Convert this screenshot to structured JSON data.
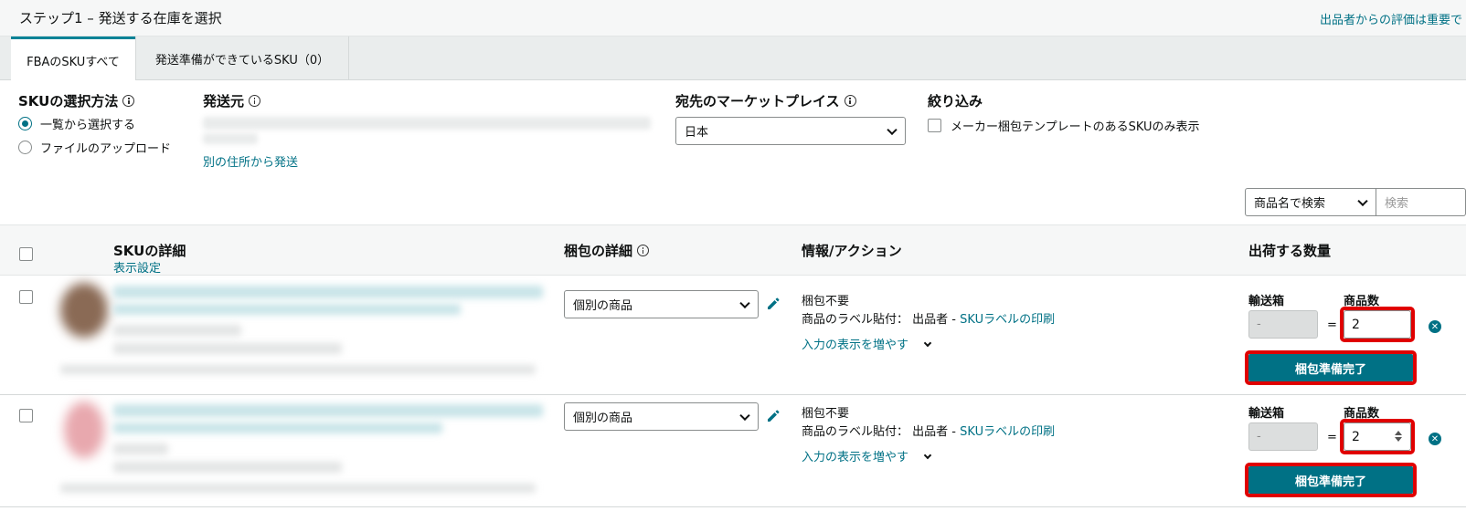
{
  "header": {
    "step_title": "ステップ1 – 発送する在庫を選択",
    "feedback_link": "出品者からの評価は重要で"
  },
  "tabs": [
    {
      "label": "FBAのSKUすべて",
      "active": true
    },
    {
      "label": "発送準備ができているSKU（0）",
      "active": false
    }
  ],
  "filters": {
    "sku_method_label": "SKUの選択方法",
    "sku_method_options": [
      {
        "label": "一覧から選択する",
        "checked": true
      },
      {
        "label": "ファイルのアップロード",
        "checked": false
      }
    ],
    "ship_from_label": "発送元",
    "ship_from_link": "別の住所から発送",
    "marketplace_label": "宛先のマーケットプレイス",
    "marketplace_value": "日本",
    "narrow_label": "絞り込み",
    "narrow_checkbox_label": "メーカー梱包テンプレートのあるSKUのみ表示"
  },
  "search": {
    "dropdown_value": "商品名で検索",
    "placeholder": "検索"
  },
  "table": {
    "headers": {
      "sku_details": "SKUの詳細",
      "display_settings": "表示設定",
      "packing_details": "梱包の詳細",
      "info_actions": "情報/アクション",
      "ship_quantity": "出荷する数量"
    },
    "rows": [
      {
        "packing_value": "個別の商品",
        "prep_text": "梱包不要",
        "label_text": "商品のラベル貼付：",
        "label_owner": "出品者",
        "label_separator": " - ",
        "label_link": "SKUラベルの印刷",
        "more_inputs": "入力の表示を増やす",
        "boxes_label": "輸送箱",
        "boxes_value": "-",
        "units_label": "商品数",
        "units_value": "2",
        "equals": "=",
        "ready_button": "梱包準備完了"
      },
      {
        "packing_value": "個別の商品",
        "prep_text": "梱包不要",
        "label_text": "商品のラベル貼付：",
        "label_owner": "出品者",
        "label_separator": " - ",
        "label_link": "SKUラベルの印刷",
        "more_inputs": "入力の表示を増やす",
        "boxes_label": "輸送箱",
        "boxes_value": "-",
        "units_label": "商品数",
        "units_value": "2",
        "equals": "=",
        "ready_button": "梱包準備完了"
      }
    ]
  },
  "colors": {
    "accent": "#007185",
    "highlight": "#e00000"
  }
}
